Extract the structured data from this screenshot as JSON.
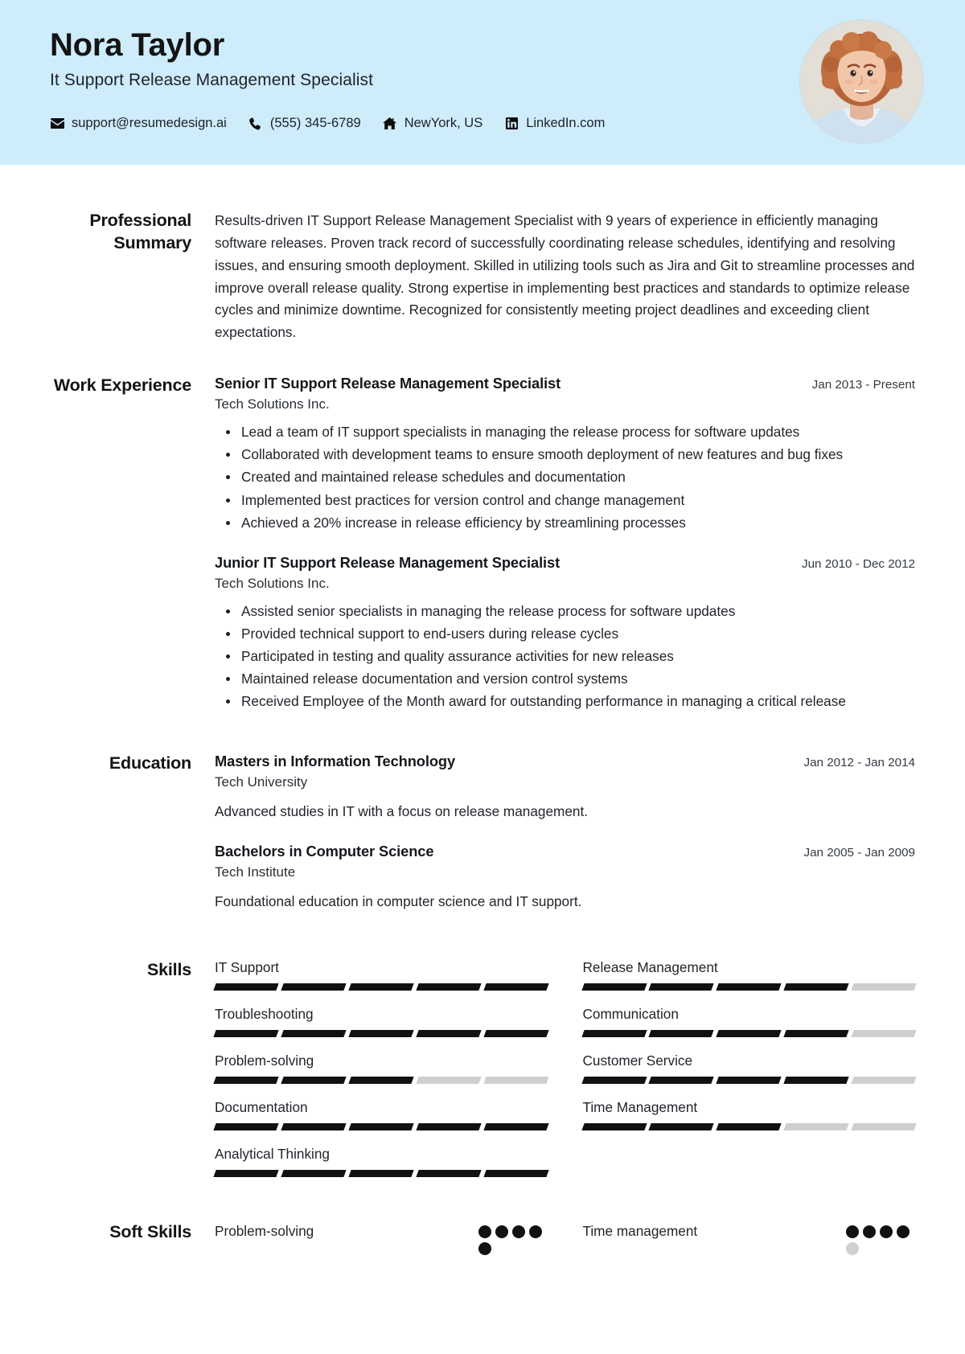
{
  "theme": {
    "header_bg": "#cfecfb",
    "accent_dark": "#111111",
    "muted": "#cfcfcf"
  },
  "header": {
    "name": "Nora Taylor",
    "job_title": "It Support Release Management Specialist",
    "contacts": [
      {
        "icon": "envelope-icon",
        "text": "support@resumedesign.ai"
      },
      {
        "icon": "phone-icon",
        "text": "(555) 345-6789"
      },
      {
        "icon": "home-icon",
        "text": "NewYork, US"
      },
      {
        "icon": "linkedin-icon",
        "text": "LinkedIn.com"
      }
    ]
  },
  "summary": {
    "label": "Professional Summary",
    "text": "Results-driven IT Support Release Management Specialist with 9 years of experience in efficiently managing software releases. Proven track record of successfully coordinating release schedules, identifying and resolving issues, and ensuring smooth deployment. Skilled in utilizing tools such as Jira and Git to streamline processes and improve overall release quality. Strong expertise in implementing best practices and standards to optimize release cycles and minimize downtime. Recognized for consistently meeting project deadlines and exceeding client expectations."
  },
  "work": {
    "label": "Work Experience",
    "entries": [
      {
        "title": "Senior IT Support Release Management Specialist",
        "org": "Tech Solutions Inc.",
        "date": "Jan 2013 - Present",
        "bullets": [
          "Lead a team of IT support specialists in managing the release process for software updates",
          "Collaborated with development teams to ensure smooth deployment of new features and bug fixes",
          "Created and maintained release schedules and documentation",
          "Implemented best practices for version control and change management",
          "Achieved a 20% increase in release efficiency by streamlining processes"
        ]
      },
      {
        "title": "Junior IT Support Release Management Specialist",
        "org": "Tech Solutions Inc.",
        "date": "Jun 2010 - Dec 2012",
        "bullets": [
          "Assisted senior specialists in managing the release process for software updates",
          "Provided technical support to end-users during release cycles",
          "Participated in testing and quality assurance activities for new releases",
          "Maintained release documentation and version control systems",
          "Received Employee of the Month award for outstanding performance in managing a critical release"
        ]
      }
    ]
  },
  "education": {
    "label": "Education",
    "entries": [
      {
        "title": "Masters in Information Technology",
        "org": "Tech University",
        "date": "Jan 2012 - Jan 2014",
        "desc": "Advanced studies in IT with a focus on release management."
      },
      {
        "title": "Bachelors in Computer Science",
        "org": "Tech Institute",
        "date": "Jan 2005 - Jan 2009",
        "desc": "Foundational education in computer science and IT support."
      }
    ]
  },
  "skills": {
    "label": "Skills",
    "max": 5,
    "items": [
      {
        "name": "IT Support",
        "level": 5
      },
      {
        "name": "Release Management",
        "level": 4
      },
      {
        "name": "Troubleshooting",
        "level": 5
      },
      {
        "name": "Communication",
        "level": 4
      },
      {
        "name": "Problem-solving",
        "level": 3
      },
      {
        "name": "Customer Service",
        "level": 4
      },
      {
        "name": "Documentation",
        "level": 5
      },
      {
        "name": "Time Management",
        "level": 3
      },
      {
        "name": "Analytical Thinking",
        "level": 5
      }
    ]
  },
  "soft_skills": {
    "label": "Soft Skills",
    "max": 5,
    "items": [
      {
        "name": "Problem-solving",
        "level": 5
      },
      {
        "name": "Time management",
        "level": 4
      }
    ]
  }
}
